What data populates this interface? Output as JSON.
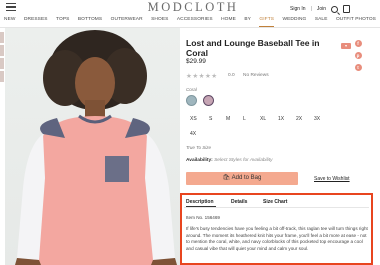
{
  "header": {
    "logo": "MODCLOTH",
    "signin": "Sign In",
    "sep": "|",
    "join": "Join"
  },
  "nav": [
    "NEW",
    "DRESSES",
    "TOPS",
    "BOTTOMS",
    "OUTERWEAR",
    "SHOES",
    "ACCESSORIES",
    "HOME",
    "BY",
    "GIFTS",
    "WEDDING",
    "SALE",
    "OUTFIT PHOTOS"
  ],
  "nav_active": "GIFTS",
  "product": {
    "title": "Lost and Lounge Baseball Tee in Coral",
    "price": "$29.99",
    "stars": "★★★★★",
    "rating": "0.0",
    "reviews": "No Reviews",
    "color_label": "Coral",
    "swatch_colors": [
      "#9fb6be",
      "#c6a5b4"
    ],
    "sizes": [
      "XS",
      "S",
      "M",
      "L",
      "XL",
      "1X",
      "2X",
      "3X",
      "4X"
    ],
    "size_guide": "True To Size",
    "availability_label": "Availability:",
    "availability_value": "Select Styles for Availability",
    "add_button": "Add to Bag",
    "wishlist": "Save to Wishlist",
    "fav_label": "♥"
  },
  "social": [
    {
      "icon": "facebook-icon",
      "glyph": "f",
      "color": "#e88d7c"
    },
    {
      "icon": "pinterest-icon",
      "glyph": "p",
      "color": "#e88d7c"
    },
    {
      "icon": "twitter-icon",
      "glyph": "t",
      "color": "#e88d7c"
    }
  ],
  "tabs": {
    "labels": [
      "Description",
      "Details",
      "Size Chart"
    ],
    "item_no": "Item No. 156469",
    "description": "If life's busy tendencies have you feeling a bit off-track, this raglan tee will turn things right around. The moment its heathered knit hits your frame, you'll feel a bit more at ease - not to mention the coral, white, and navy colorblocks of this pocketed top encourage a cool and casual vibe that will quiet your mind and calm your soul."
  },
  "colors": {
    "accent": "#f4a98f",
    "highlight_box": "#e8451f",
    "nav_active": "#c0803a"
  }
}
